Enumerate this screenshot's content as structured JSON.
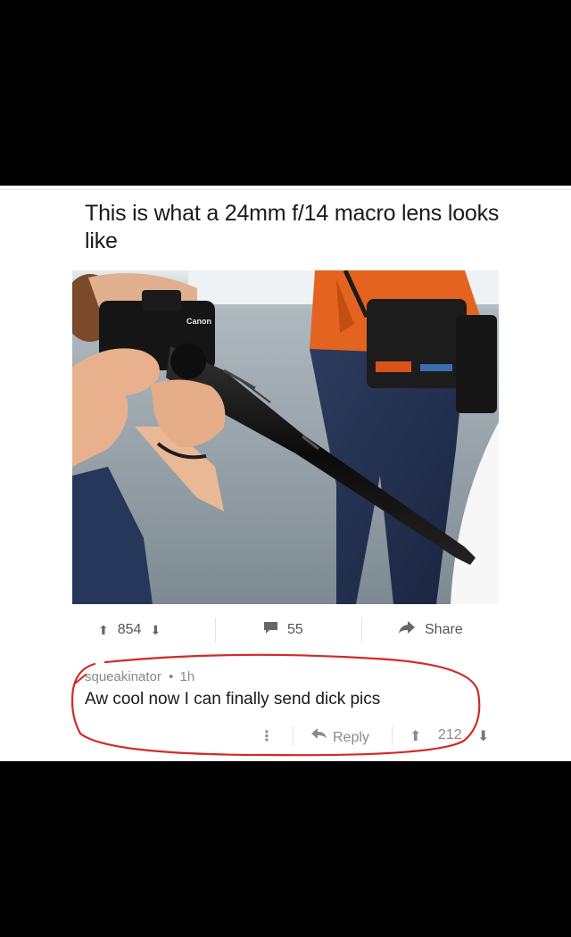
{
  "post": {
    "title": "This is what a 24mm f/14 macro lens looks like",
    "camera_brand": "Canon"
  },
  "actions": {
    "upvotes": "854",
    "comments": "55",
    "share_label": "Share"
  },
  "comment": {
    "username": "squeakinator",
    "separator": "•",
    "age": "1h",
    "text": "Aw cool now I can finally send dick pics",
    "more_label": "⋮",
    "reply_label": "Reply",
    "votes": "212"
  },
  "colors": {
    "annotation": "#d22a2a",
    "text": "#1a1a1a",
    "muted": "#888888"
  }
}
